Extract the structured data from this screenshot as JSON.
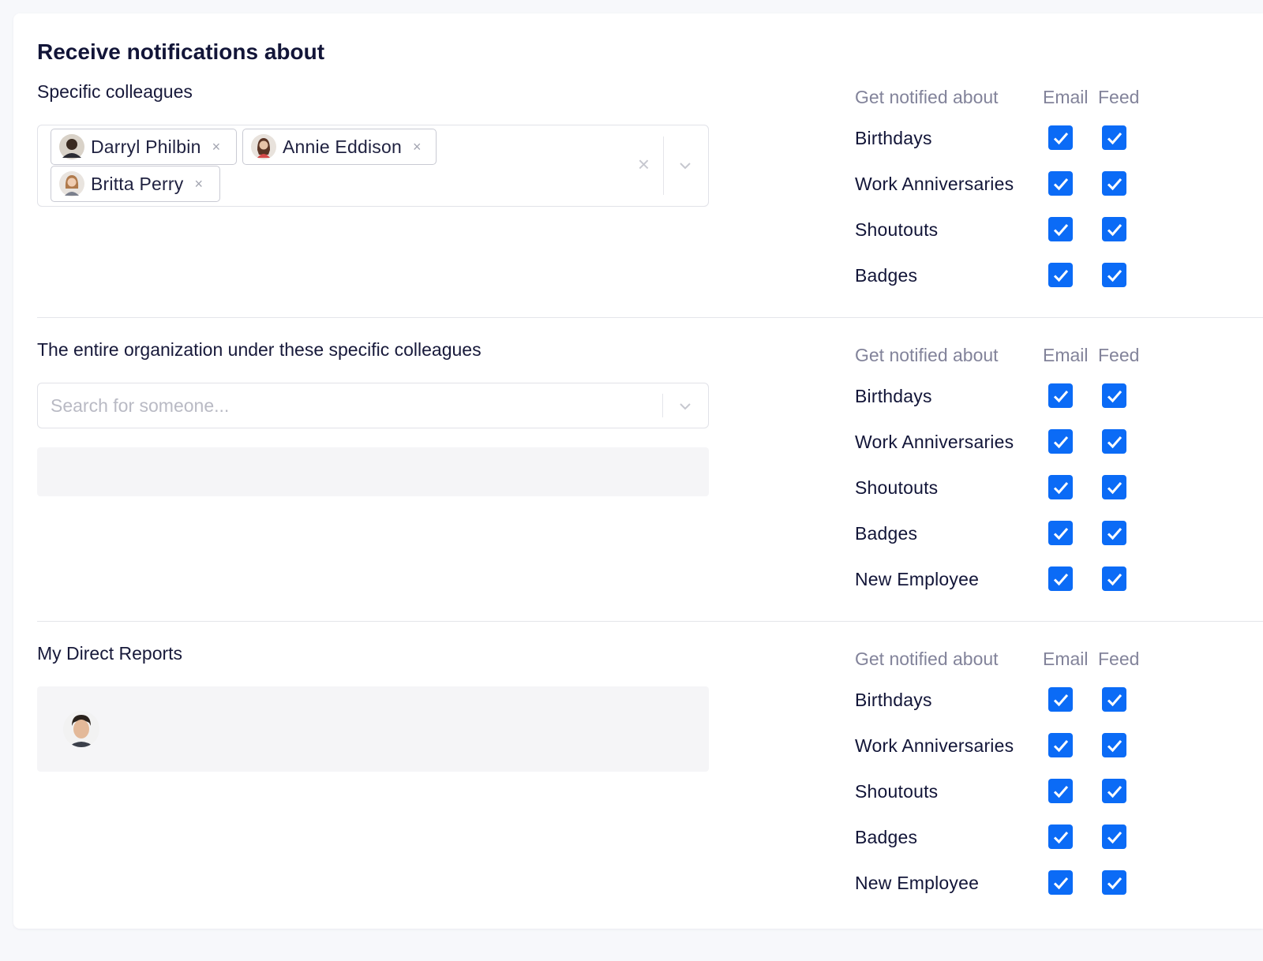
{
  "page": {
    "title": "Receive notifications about"
  },
  "table_header": {
    "topic": "Get notified about",
    "email": "Email",
    "feed": "Feed"
  },
  "sections": [
    {
      "label": "Specific colleagues",
      "selected_people": [
        {
          "name": "Darryl Philbin",
          "remove": "×"
        },
        {
          "name": "Annie Eddison",
          "remove": "×"
        },
        {
          "name": "Britta Perry",
          "remove": "×"
        }
      ],
      "clear_icon": "×",
      "notifications": [
        {
          "label": "Birthdays",
          "email": true,
          "feed": true
        },
        {
          "label": "Work Anniversaries",
          "email": true,
          "feed": true
        },
        {
          "label": "Shoutouts",
          "email": true,
          "feed": true
        },
        {
          "label": "Badges",
          "email": true,
          "feed": true
        }
      ]
    },
    {
      "label": "The entire organization under these specific colleagues",
      "search_placeholder": "Search for someone...",
      "notifications": [
        {
          "label": "Birthdays",
          "email": true,
          "feed": true
        },
        {
          "label": "Work Anniversaries",
          "email": true,
          "feed": true
        },
        {
          "label": "Shoutouts",
          "email": true,
          "feed": true
        },
        {
          "label": "Badges",
          "email": true,
          "feed": true
        },
        {
          "label": "New Employee",
          "email": true,
          "feed": true
        }
      ]
    },
    {
      "label": "My Direct Reports",
      "notifications": [
        {
          "label": "Birthdays",
          "email": true,
          "feed": true
        },
        {
          "label": "Work Anniversaries",
          "email": true,
          "feed": true
        },
        {
          "label": "Shoutouts",
          "email": true,
          "feed": true
        },
        {
          "label": "Badges",
          "email": true,
          "feed": true
        },
        {
          "label": "New Employee",
          "email": true,
          "feed": true
        }
      ]
    }
  ],
  "colors": {
    "checkbox": "#0b6bf6",
    "heading": "#121538",
    "muted": "#82839a"
  },
  "icons": {
    "checkbox_checked": "check-icon",
    "chip_remove": "close-icon",
    "dropdown": "chevron-down-icon",
    "avatar": "avatar-icon"
  }
}
